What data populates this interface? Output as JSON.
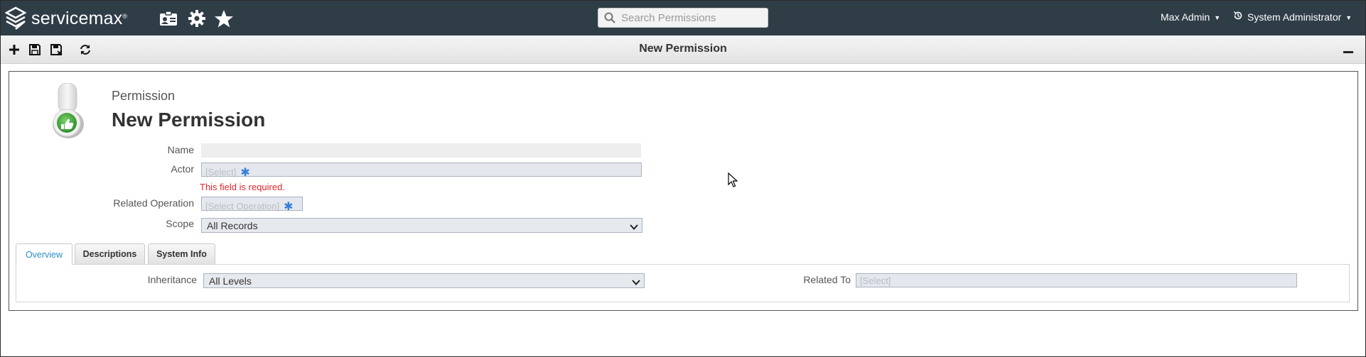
{
  "brand": {
    "name": "servicemax",
    "reg_mark": "®"
  },
  "nav": {
    "icons": [
      "contact-card-icon",
      "gear-icon",
      "star-icon"
    ],
    "search": {
      "placeholder": "Search Permissions",
      "value": ""
    },
    "user_label": "Max Admin",
    "role_label": "System Administrator"
  },
  "toolbar": {
    "title": "New Permission",
    "buttons": [
      "new-icon",
      "save-icon",
      "save-close-icon",
      "refresh-icon"
    ]
  },
  "record": {
    "type_label": "Permission",
    "title": "New Permission"
  },
  "fields": {
    "name": {
      "label": "Name",
      "value": ""
    },
    "actor": {
      "label": "Actor",
      "placeholder": "[Select]",
      "required_mark": "✱",
      "error": "This field is required."
    },
    "related_operation": {
      "label": "Related Operation",
      "placeholder": "[Select Operation]",
      "required_mark": "✱"
    },
    "scope": {
      "label": "Scope",
      "value": "All Records"
    }
  },
  "tabs": [
    {
      "label": "Overview",
      "active": true
    },
    {
      "label": "Descriptions",
      "active": false
    },
    {
      "label": "System Info",
      "active": false
    }
  ],
  "overview": {
    "inheritance": {
      "label": "Inheritance",
      "value": "All Levels"
    },
    "related_to": {
      "label": "Related To",
      "placeholder": "[Select]"
    }
  },
  "colors": {
    "topbar": "#2f3d47",
    "error": "#e1262d",
    "required": "#3a7fd6",
    "tab_active_text": "#2a8fc4"
  }
}
